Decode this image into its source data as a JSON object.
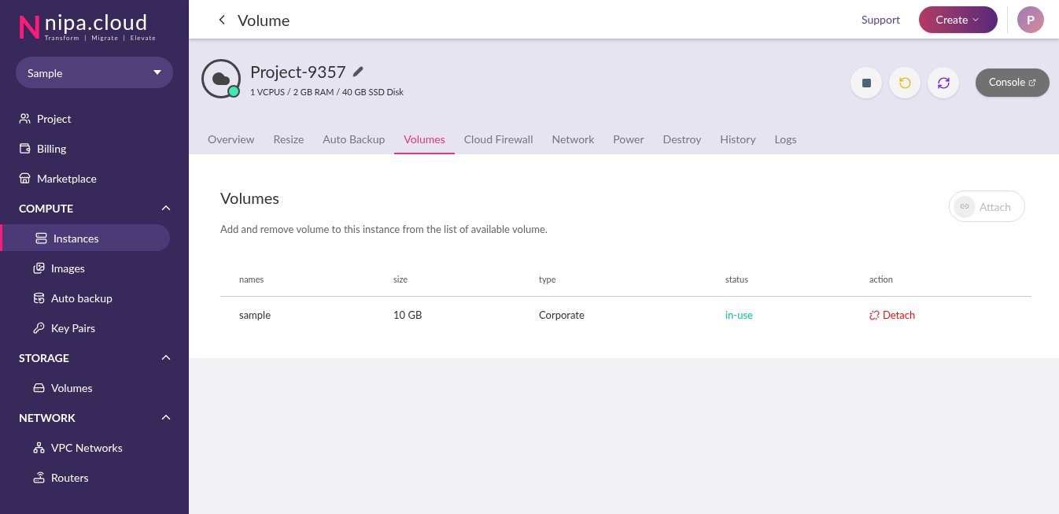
{
  "logo": {
    "mark": "N",
    "name": "nipa.cloud",
    "tagline": "Transform  |  Migrate  |  Elevate"
  },
  "project_select": {
    "value": "Sample"
  },
  "sidebar": {
    "items": [
      {
        "label": "Project",
        "selected": false
      },
      {
        "label": "Billing",
        "selected": false
      },
      {
        "label": "Marketplace",
        "selected": false
      }
    ],
    "sections": [
      {
        "title": "COMPUTE",
        "expanded": true,
        "items": [
          {
            "label": "Instances",
            "selected": true
          },
          {
            "label": "Images",
            "selected": false
          },
          {
            "label": "Auto backup",
            "selected": false
          },
          {
            "label": "Key Pairs",
            "selected": false
          }
        ]
      },
      {
        "title": "STORAGE",
        "expanded": true,
        "items": [
          {
            "label": "Volumes",
            "selected": false
          }
        ]
      },
      {
        "title": "NETWORK",
        "expanded": true,
        "items": [
          {
            "label": "VPC Networks",
            "selected": false
          },
          {
            "label": "Routers",
            "selected": false
          }
        ]
      }
    ]
  },
  "header": {
    "title": "Volume",
    "support": "Support",
    "create": "Create",
    "avatar": "P"
  },
  "instance": {
    "name": "Project-9357",
    "specs": "1 VCPUS / 2 GB RAM / 40 GB SSD Disk",
    "running": true,
    "console": "Console"
  },
  "tabs": [
    {
      "label": "Overview",
      "selected": false
    },
    {
      "label": "Resize",
      "selected": false
    },
    {
      "label": "Auto Backup",
      "selected": false
    },
    {
      "label": "Volumes",
      "selected": true
    },
    {
      "label": "Cloud Firewall",
      "selected": false
    },
    {
      "label": "Network",
      "selected": false
    },
    {
      "label": "Power",
      "selected": false
    },
    {
      "label": "Destroy",
      "selected": false
    },
    {
      "label": "History",
      "selected": false
    },
    {
      "label": "Logs",
      "selected": false
    }
  ],
  "volumes": {
    "title": "Volumes",
    "description": "Add and remove volume to this instance from the list of available volume.",
    "attach": {
      "label": "Attach",
      "disabled": true
    },
    "table": {
      "columns": [
        "names",
        "size",
        "type",
        "status",
        "action"
      ],
      "rows": [
        {
          "name": "sample",
          "size": "10 GB",
          "type": "Corporate",
          "status": "in-use",
          "color": "#00c7a8",
          "action": "Detach"
        }
      ]
    }
  }
}
